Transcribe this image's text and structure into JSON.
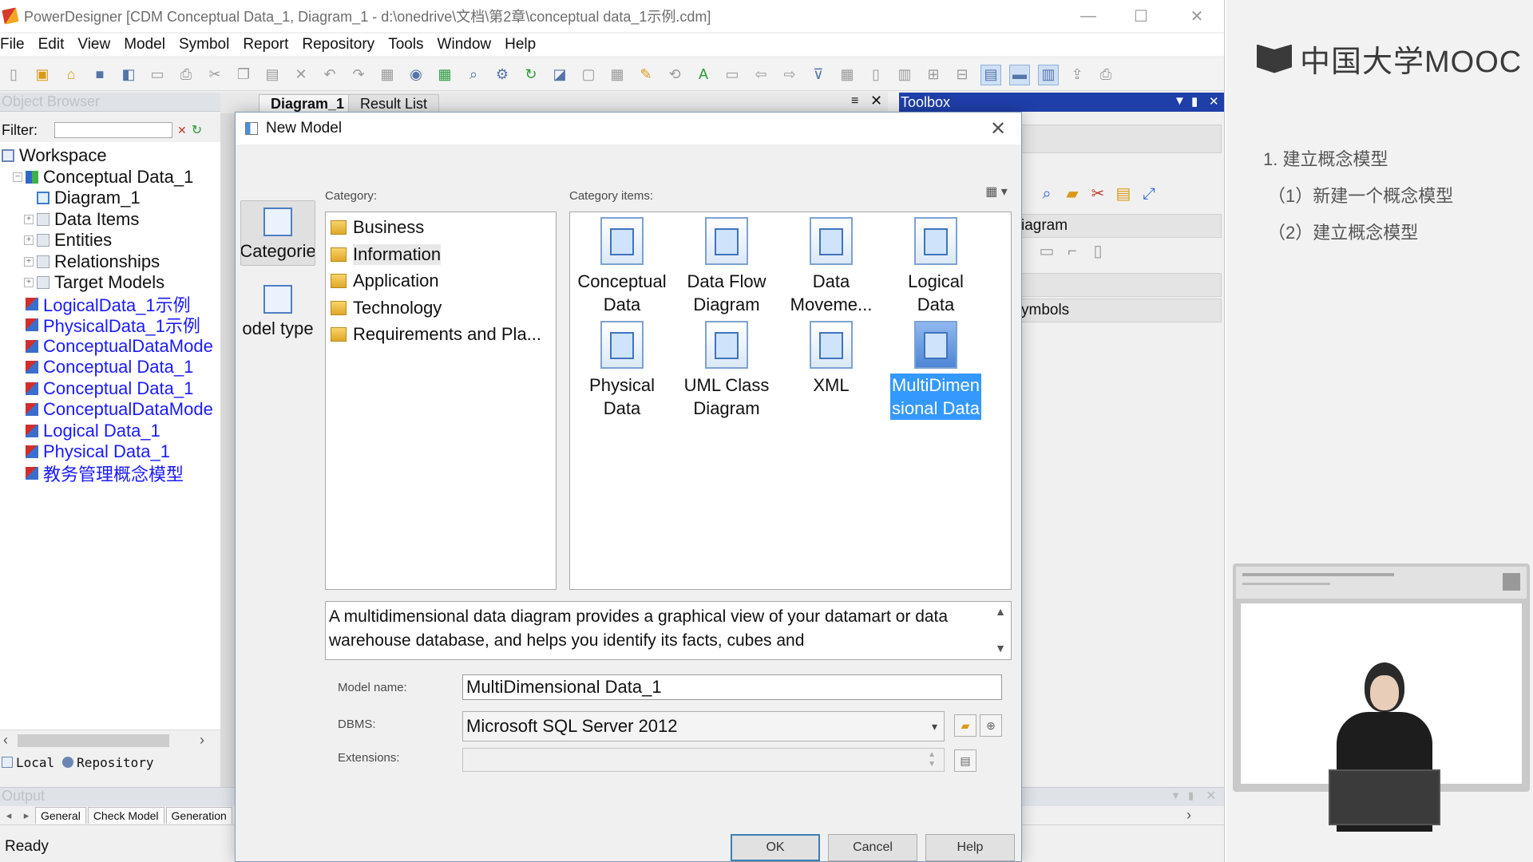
{
  "app": {
    "title": "PowerDesigner [CDM Conceptual Data_1, Diagram_1 - d:\\onedrive\\文档\\第2章\\conceptual data_1示例.cdm]",
    "window_controls": [
      "—",
      "☐",
      "✕"
    ]
  },
  "menu": [
    "File",
    "Edit",
    "View",
    "Model",
    "Symbol",
    "Report",
    "Repository",
    "Tools",
    "Window",
    "Help"
  ],
  "object_browser": {
    "title": "Object Browser",
    "filter_label": "Filter:",
    "filter_value": "",
    "tree": [
      {
        "label": "Workspace",
        "level": 0,
        "icon": "workspace-icon",
        "link": false
      },
      {
        "label": "Conceptual Data_1",
        "level": 1,
        "icon": "cdm-icon",
        "link": false,
        "expander": "−"
      },
      {
        "label": "Diagram_1",
        "level": 2,
        "icon": "diagram-icon",
        "link": false
      },
      {
        "label": "Data Items",
        "level": 2,
        "icon": "folder-icon",
        "link": false,
        "expander": "+"
      },
      {
        "label": "Entities",
        "level": 2,
        "icon": "folder-icon",
        "link": false,
        "expander": "+"
      },
      {
        "label": "Relationships",
        "level": 2,
        "icon": "folder-icon",
        "link": false,
        "expander": "+"
      },
      {
        "label": "Target Models",
        "level": 2,
        "icon": "folder-icon",
        "link": false,
        "expander": "+"
      },
      {
        "label": "LogicalData_1示例",
        "level": 1,
        "icon": "model-icon",
        "link": true
      },
      {
        "label": "PhysicalData_1示例",
        "level": 1,
        "icon": "model-icon",
        "link": true
      },
      {
        "label": "ConceptualDataMode",
        "level": 1,
        "icon": "model-icon",
        "link": true
      },
      {
        "label": "Conceptual Data_1",
        "level": 1,
        "icon": "model-icon",
        "link": true
      },
      {
        "label": "Conceptual Data_1",
        "level": 1,
        "icon": "model-icon",
        "link": true
      },
      {
        "label": "ConceptualDataMode",
        "level": 1,
        "icon": "model-icon",
        "link": true
      },
      {
        "label": "Logical Data_1",
        "level": 1,
        "icon": "model-icon",
        "link": true
      },
      {
        "label": "Physical Data_1",
        "level": 1,
        "icon": "model-icon",
        "link": true
      },
      {
        "label": "教务管理概念模型",
        "level": 1,
        "icon": "model-icon",
        "link": true
      }
    ],
    "tabs": [
      "Local",
      "Repository"
    ]
  },
  "diagram_tabs": [
    "Diagram_1",
    "Result List"
  ],
  "toolbox": {
    "title": "Toolbox",
    "sections": [
      "iagram",
      "ymbols"
    ]
  },
  "output": {
    "title": "Output",
    "tabs": [
      "General",
      "Check Model",
      "Generation"
    ]
  },
  "status": "Ready",
  "dialog": {
    "title": "New Model",
    "rail": [
      {
        "label": "Categorie",
        "active": true
      },
      {
        "label": "odel type",
        "active": false
      }
    ],
    "category_caption": "Category:",
    "items_caption": "Category items:",
    "categories": [
      {
        "label": "Business",
        "selected": false
      },
      {
        "label": "Information",
        "selected": true
      },
      {
        "label": "Application",
        "selected": false
      },
      {
        "label": "Technology",
        "selected": false
      },
      {
        "label": "Requirements and Pla...",
        "selected": false
      }
    ],
    "items": [
      {
        "line1": "Conceptual",
        "line2": "Data",
        "selected": false
      },
      {
        "line1": "Data Flow",
        "line2": "Diagram",
        "selected": false
      },
      {
        "line1": "Data",
        "line2": "Moveme...",
        "selected": false
      },
      {
        "line1": "Logical",
        "line2": "Data",
        "selected": false
      },
      {
        "line1": "Physical",
        "line2": "Data",
        "selected": false
      },
      {
        "line1": "UML Class",
        "line2": "Diagram",
        "selected": false
      },
      {
        "line1": "XML",
        "line2": "",
        "selected": false
      },
      {
        "line1": "MultiDimen",
        "line2": "sional Data",
        "selected": true
      }
    ],
    "description": "A multidimensional data diagram provides a graphical view of your datamart or data warehouse database, and helps you identify its facts, cubes and",
    "model_name_label": "Model name:",
    "model_name_value": "MultiDimensional Data_1",
    "dbms_label": "DBMS:",
    "dbms_value": "Microsoft SQL Server 2012",
    "extensions_label": "Extensions:",
    "extensions_value": "",
    "buttons": {
      "ok": "OK",
      "cancel": "Cancel",
      "help": "Help"
    }
  },
  "mooc": {
    "logo": "中国大学MOOC",
    "outline": [
      "1. 建立概念模型",
      "（1）新建一个概念模型",
      "（2）建立概念模型"
    ]
  },
  "colors": {
    "toolbox_header": "#1e3fa8",
    "selection": "#3399ff",
    "link_text": "#1a1aff"
  }
}
